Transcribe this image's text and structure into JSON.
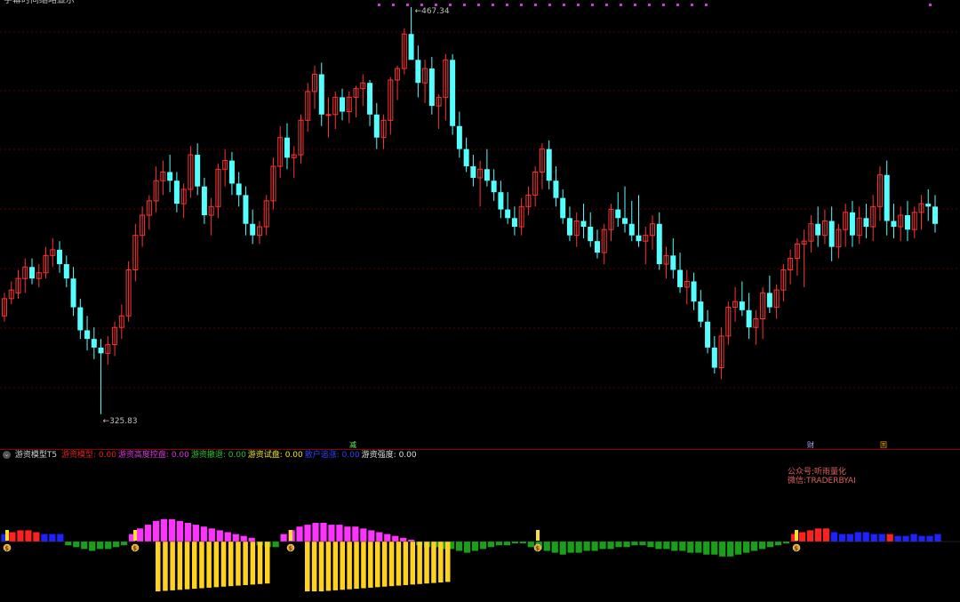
{
  "header": {
    "title_fragment": "字幕时间缩略显示"
  },
  "chart_data": {
    "type": "candlestick",
    "price_high_label": "467.34",
    "price_low_label": "325.83",
    "price_high": 467.34,
    "price_low": 325.83,
    "ylim": [
      300,
      470
    ],
    "up_color": "#ff3232",
    "down_color": "#54ffff",
    "candles": [
      [
        360,
        368,
        358,
        366
      ],
      [
        366,
        372,
        364,
        369
      ],
      [
        368,
        376,
        366,
        373
      ],
      [
        373,
        380,
        368,
        377
      ],
      [
        377,
        380,
        371,
        373
      ],
      [
        373,
        378,
        370,
        375
      ],
      [
        375,
        384,
        373,
        381
      ],
      [
        381,
        387,
        377,
        383
      ],
      [
        383,
        386,
        375,
        378
      ],
      [
        378,
        381,
        370,
        373
      ],
      [
        373,
        377,
        360,
        363
      ],
      [
        363,
        366,
        352,
        355
      ],
      [
        355,
        360,
        348,
        352
      ],
      [
        352,
        356,
        345,
        349
      ],
      [
        349,
        352,
        325.83,
        347
      ],
      [
        347,
        353,
        343,
        350
      ],
      [
        350,
        358,
        346,
        356
      ],
      [
        356,
        364,
        352,
        360
      ],
      [
        360,
        379,
        358,
        376
      ],
      [
        376,
        392,
        372,
        388
      ],
      [
        388,
        398,
        384,
        395
      ],
      [
        395,
        402,
        390,
        400
      ],
      [
        400,
        412,
        396,
        407
      ],
      [
        407,
        414,
        402,
        410
      ],
      [
        410,
        416,
        403,
        407
      ],
      [
        407,
        410,
        396,
        399
      ],
      [
        399,
        406,
        394,
        404
      ],
      [
        404,
        419,
        401,
        416
      ],
      [
        416,
        420,
        402,
        405
      ],
      [
        405,
        408,
        392,
        395
      ],
      [
        395,
        401,
        388,
        398
      ],
      [
        398,
        413,
        394,
        411
      ],
      [
        411,
        418,
        405,
        414
      ],
      [
        414,
        417,
        402,
        406
      ],
      [
        406,
        410,
        398,
        402
      ],
      [
        402,
        405,
        388,
        392
      ],
      [
        392,
        397,
        385,
        388
      ],
      [
        388,
        393,
        385,
        391
      ],
      [
        391,
        402,
        388,
        400
      ],
      [
        400,
        415,
        397,
        412
      ],
      [
        412,
        426,
        408,
        422
      ],
      [
        422,
        427,
        411,
        415
      ],
      [
        415,
        419,
        408,
        416
      ],
      [
        416,
        430,
        413,
        428
      ],
      [
        428,
        441,
        424,
        438
      ],
      [
        438,
        447,
        432,
        444
      ],
      [
        444,
        448,
        426,
        430
      ],
      [
        430,
        436,
        422,
        430
      ],
      [
        430,
        438,
        425,
        436
      ],
      [
        436,
        439,
        428,
        431
      ],
      [
        431,
        438,
        427,
        436
      ],
      [
        436,
        440,
        429,
        439
      ],
      [
        439,
        444,
        433,
        441
      ],
      [
        441,
        442,
        426,
        430
      ],
      [
        430,
        434,
        418,
        422
      ],
      [
        422,
        430,
        418,
        428
      ],
      [
        428,
        443,
        423,
        442
      ],
      [
        442,
        447,
        435,
        446
      ],
      [
        446,
        460,
        444,
        458
      ],
      [
        458,
        467.34,
        450,
        449
      ],
      [
        449,
        454,
        436,
        441
      ],
      [
        441,
        449,
        434,
        446
      ],
      [
        446,
        450,
        430,
        433
      ],
      [
        433,
        437,
        425,
        436
      ],
      [
        436,
        451,
        428,
        449
      ],
      [
        449,
        451,
        423,
        426
      ],
      [
        426,
        431,
        415,
        418
      ],
      [
        418,
        422,
        410,
        412
      ],
      [
        412,
        416,
        405,
        408
      ],
      [
        408,
        414,
        398,
        411
      ],
      [
        411,
        418,
        405,
        407
      ],
      [
        407,
        411,
        400,
        403
      ],
      [
        403,
        407,
        394,
        397
      ],
      [
        397,
        403,
        392,
        394
      ],
      [
        394,
        398,
        388,
        391
      ],
      [
        391,
        401,
        388,
        398
      ],
      [
        398,
        405,
        395,
        402
      ],
      [
        402,
        412,
        398,
        410
      ],
      [
        410,
        420,
        404,
        418
      ],
      [
        418,
        421,
        404,
        407
      ],
      [
        407,
        412,
        398,
        401
      ],
      [
        401,
        404,
        392,
        394
      ],
      [
        394,
        398,
        386,
        388
      ],
      [
        388,
        396,
        384,
        393
      ],
      [
        393,
        399,
        387,
        391
      ],
      [
        391,
        396,
        384,
        386
      ],
      [
        386,
        390,
        380,
        382
      ],
      [
        382,
        392,
        378,
        390
      ],
      [
        390,
        399,
        386,
        397
      ],
      [
        397,
        403,
        391,
        394
      ],
      [
        394,
        405,
        389,
        392
      ],
      [
        392,
        400,
        386,
        388
      ],
      [
        388,
        402,
        384,
        386
      ],
      [
        386,
        391,
        378,
        388
      ],
      [
        388,
        395,
        383,
        392
      ],
      [
        392,
        396,
        376,
        378
      ],
      [
        378,
        384,
        373,
        381
      ],
      [
        381,
        387,
        373,
        376
      ],
      [
        376,
        382,
        368,
        370
      ],
      [
        370,
        376,
        364,
        372
      ],
      [
        372,
        375,
        362,
        365
      ],
      [
        365,
        369,
        356,
        358
      ],
      [
        358,
        362,
        347,
        349
      ],
      [
        349,
        353,
        340,
        342
      ],
      [
        342,
        356,
        338,
        353
      ],
      [
        353,
        365,
        350,
        363
      ],
      [
        363,
        370,
        358,
        365
      ],
      [
        365,
        372,
        360,
        362
      ],
      [
        362,
        368,
        352,
        356
      ],
      [
        356,
        362,
        350,
        359
      ],
      [
        359,
        370,
        352,
        368
      ],
      [
        368,
        374,
        361,
        363
      ],
      [
        363,
        371,
        359,
        369
      ],
      [
        369,
        378,
        365,
        376
      ],
      [
        376,
        383,
        371,
        380
      ],
      [
        380,
        387,
        374,
        385
      ],
      [
        385,
        390,
        370,
        386
      ],
      [
        386,
        395,
        382,
        392
      ],
      [
        392,
        398,
        384,
        388
      ],
      [
        388,
        397,
        385,
        393
      ],
      [
        393,
        398,
        379,
        384
      ],
      [
        384,
        392,
        380,
        390
      ],
      [
        390,
        399,
        384,
        396
      ],
      [
        396,
        400,
        384,
        388
      ],
      [
        388,
        398,
        385,
        394
      ],
      [
        394,
        399,
        387,
        391
      ],
      [
        391,
        402,
        386,
        398
      ],
      [
        398,
        412,
        393,
        409
      ],
      [
        409,
        414,
        388,
        393
      ],
      [
        393,
        399,
        387,
        391
      ],
      [
        391,
        398,
        386,
        395
      ],
      [
        395,
        400,
        386,
        390
      ],
      [
        390,
        398,
        387,
        396
      ],
      [
        396,
        402,
        390,
        399
      ],
      [
        399,
        404,
        393,
        398
      ],
      [
        398,
        402,
        389,
        392
      ]
    ],
    "indicator": {
      "title": "游资模型T5",
      "items": [
        {
          "name": "游资模型:",
          "value": "0.00",
          "color": "#e02020"
        },
        {
          "name": "游资高度控盘:",
          "value": "0.00",
          "color": "#e030e0"
        },
        {
          "name": "游资撤退:",
          "value": "0.00",
          "color": "#30c030"
        },
        {
          "name": "游资试盘:",
          "value": "0.00",
          "color": "#e8e820"
        },
        {
          "name": "散户追涨:",
          "value": "0.00",
          "color": "#3040ff"
        },
        {
          "name": "游资强度:",
          "value": "0.00",
          "color": "#e0e0e0"
        }
      ],
      "bars": [
        2,
        2.5,
        3,
        3,
        2.5,
        2,
        2,
        2,
        -1,
        -1.5,
        -2,
        -2.5,
        -2,
        -2,
        -1.5,
        -1,
        2,
        3.5,
        4.5,
        5.5,
        6,
        6,
        5.5,
        5,
        4.5,
        4,
        3.5,
        3,
        2.5,
        2,
        1.5,
        1,
        -1,
        -1.5,
        -1.5,
        2,
        3,
        4,
        4.5,
        5,
        5,
        4.5,
        4.5,
        4,
        4,
        3.5,
        3,
        2.5,
        2,
        1.5,
        1,
        0.5,
        -1,
        -1.5,
        -1.5,
        -2,
        -2,
        -2.5,
        -3,
        -2.5,
        -2,
        -1.5,
        -1,
        -1,
        -0.5,
        -0.5,
        -1.5,
        -2,
        -2.5,
        -3,
        -3.5,
        -3,
        -3,
        -2.5,
        -2.5,
        -2,
        -2,
        -1.5,
        -1.5,
        -1,
        -1,
        -1.5,
        -2,
        -2,
        -2.5,
        -2.5,
        -3,
        -3,
        -3.5,
        -3.5,
        -4,
        -4,
        -3.5,
        -3,
        -2.5,
        -2,
        -1.5,
        -1,
        -0.5,
        2,
        2.5,
        3,
        3.5,
        3.5,
        2.5,
        2,
        2,
        2.5,
        2.5,
        2,
        2,
        2,
        1.5,
        1.5,
        2,
        1.5,
        1.5,
        2
      ],
      "bar_colors": [
        "b",
        "r",
        "r",
        "r",
        "r",
        "b",
        "b",
        "b",
        "g",
        "g",
        "g",
        "g",
        "g",
        "g",
        "g",
        "g",
        "m",
        "m",
        "m",
        "m",
        "m",
        "m",
        "m",
        "m",
        "m",
        "m",
        "m",
        "m",
        "m",
        "m",
        "m",
        "m",
        "g",
        "g",
        "g",
        "m",
        "m",
        "m",
        "m",
        "m",
        "m",
        "m",
        "m",
        "m",
        "m",
        "m",
        "m",
        "m",
        "m",
        "m",
        "m",
        "m",
        "g",
        "g",
        "g",
        "g",
        "g",
        "g",
        "g",
        "g",
        "g",
        "g",
        "g",
        "g",
        "g",
        "g",
        "g",
        "g",
        "g",
        "g",
        "g",
        "g",
        "g",
        "g",
        "g",
        "g",
        "g",
        "g",
        "g",
        "g",
        "g",
        "g",
        "g",
        "g",
        "g",
        "g",
        "g",
        "g",
        "g",
        "g",
        "g",
        "g",
        "g",
        "g",
        "g",
        "g",
        "g",
        "g",
        "g",
        "r",
        "r",
        "r",
        "r",
        "r",
        "b",
        "b",
        "b",
        "b",
        "b",
        "b",
        "b",
        "r",
        "b",
        "b",
        "b",
        "b",
        "b",
        "b"
      ],
      "yellow_bars_group1": [
        -9.5,
        -9.4,
        -9.3,
        -9.2,
        -9.1,
        -9,
        -8.9,
        -8.8,
        -8.7,
        -8.6,
        -8.5,
        -8.4,
        -8.3,
        -8.2,
        -8.1,
        -8
      ],
      "yellow_bars_group2": [
        -9.5,
        -9.5,
        -9.5,
        -9.4,
        -9.3,
        -9.2,
        -9.1,
        -9,
        -8.9,
        -8.8,
        -8.7,
        -8.6,
        -8.5,
        -8.4,
        -8.3,
        -8.2,
        -8.1,
        -8,
        -7.9,
        -7.8,
        -7.7
      ],
      "markers": [
        "$",
        "$",
        "$",
        "$",
        "$"
      ]
    },
    "signals": [
      {
        "label": "减",
        "color": "#66ff66"
      },
      {
        "label": "财",
        "color": "#aaaaff"
      },
      {
        "label": "囯",
        "color": "#ffaa00"
      }
    ]
  },
  "watermark": {
    "line1": "公众号:听雨量化",
    "line2": "微信:TRADERBYAI"
  }
}
